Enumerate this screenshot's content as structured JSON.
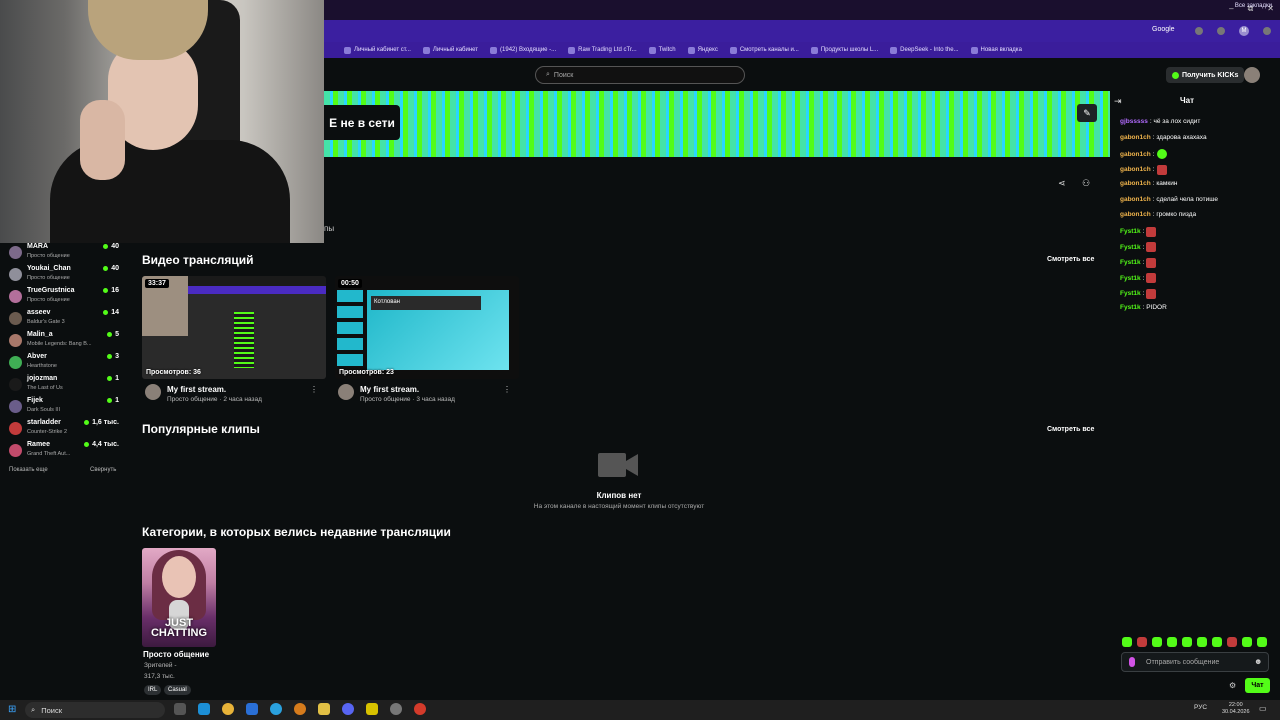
{
  "browser": {
    "bookmarks": [
      "Личный кабинет ст...",
      "Личный кабинет",
      "(1942) Входящие -...",
      "Raw Trading Ltd cTr...",
      "Twitch",
      "Яндекс",
      "Смотреть каналы и...",
      "Продукты школы L...",
      "DeepSeek - Into the...",
      "Новая вкладка"
    ],
    "all_bookmarks": "Все закладки",
    "google": "Google",
    "profile_initial": "M",
    "window_controls": [
      "–",
      "⧉",
      "✕"
    ]
  },
  "header": {
    "search_placeholder": "Поиск",
    "kicks_button": "Получить KICKs"
  },
  "banner": {
    "offline_text": "Е не в сети",
    "partial_tab": "пы"
  },
  "sidebar": {
    "channels": [
      {
        "name": "MARA",
        "category": "Просто общение",
        "viewers": "40"
      },
      {
        "name": "Youkai_Chan",
        "category": "Просто общение",
        "viewers": "40"
      },
      {
        "name": "TrueGrustnica",
        "category": "Просто общение",
        "viewers": "16"
      },
      {
        "name": "asseev",
        "category": "Baldur's Gate 3",
        "viewers": "14"
      },
      {
        "name": "Malin_a",
        "category": "Mobile Legends: Bang B...",
        "viewers": "5"
      },
      {
        "name": "Abver",
        "category": "Hearthstone",
        "viewers": "3"
      },
      {
        "name": "jojozman",
        "category": "The Last of Us",
        "viewers": "1"
      },
      {
        "name": "Fijek",
        "category": "Dark Souls III",
        "viewers": "1"
      },
      {
        "name": "starladder",
        "category": "Counter-Strike 2",
        "viewers": "1,6 тыс."
      },
      {
        "name": "Ramee",
        "category": "Grand Theft Aut...",
        "viewers": "4,4 тыс."
      }
    ],
    "show_more": "Показать еще",
    "collapse": "Свернуть"
  },
  "videos": {
    "title": "Видео трансляций",
    "see_all": "Смотреть все",
    "items": [
      {
        "duration": "33:37",
        "views": "Просмотров: 36",
        "title": "My first stream.",
        "meta": "Просто общение · 2 часа назад"
      },
      {
        "duration": "00:50",
        "views": "Просмотров: 23",
        "title": "My first stream.",
        "meta": "Просто общение · 3 часа назад",
        "slide_title": "Котлован"
      }
    ]
  },
  "clips": {
    "title": "Популярные клипы",
    "see_all": "Смотреть все",
    "empty_title": "Клипов нет",
    "empty_sub": "На этом канале в настоящий момент клипы отсутствуют"
  },
  "categories": {
    "title": "Категории, в которых велись недавние трансляции",
    "card_text": "JUST CHATTING",
    "name": "Просто общение",
    "viewers_label": "Зрителей -",
    "viewers": "317,3 тыс.",
    "tags": [
      "IRL",
      "Casual"
    ]
  },
  "chat": {
    "title": "Чат",
    "messages": [
      {
        "user": "gjbsssss",
        "text": ": чё за лох сидит",
        "color": "#b26bff",
        "emote": ""
      },
      {
        "user": "gabon1ch",
        "text": ": здарова ахахаха",
        "color": "#f0b44c",
        "emote": ""
      },
      {
        "user": "gabon1ch",
        "text": ":",
        "color": "#f0b44c",
        "emote": "alien"
      },
      {
        "user": "gabon1ch",
        "text": ":",
        "color": "#f0b44c",
        "emote": "red"
      },
      {
        "user": "gabon1ch",
        "text": ": камкин",
        "color": "#f0b44c",
        "emote": ""
      },
      {
        "user": "gabon1ch",
        "text": ": сделай чела потише",
        "color": "#f0b44c",
        "emote": ""
      },
      {
        "user": "gabon1ch",
        "text": ": громко пизда",
        "color": "#f0b44c",
        "emote": ""
      },
      {
        "user": "Fyst1k",
        "text": ":",
        "color": "#53fc18",
        "emote": "red"
      },
      {
        "user": "Fyst1k",
        "text": ":",
        "color": "#53fc18",
        "emote": "red"
      },
      {
        "user": "Fyst1k",
        "text": ":",
        "color": "#53fc18",
        "emote": "red"
      },
      {
        "user": "Fyst1k",
        "text": ":",
        "color": "#53fc18",
        "emote": "red"
      },
      {
        "user": "Fyst1k",
        "text": ":",
        "color": "#53fc18",
        "emote": "red"
      },
      {
        "user": "Fyst1k",
        "text": ": PIDOR",
        "color": "#53fc18",
        "emote": ""
      }
    ],
    "input_placeholder": "Отправить сообщение",
    "send_label": "Чат"
  },
  "taskbar": {
    "search_label": "Поиск",
    "lang": "РУС",
    "time": "22:00",
    "date": "30.04.2026"
  },
  "colors": {
    "accent": "#53fc18",
    "background": "#0b0e0f",
    "bookmark_bar": "#3a1d9b"
  }
}
